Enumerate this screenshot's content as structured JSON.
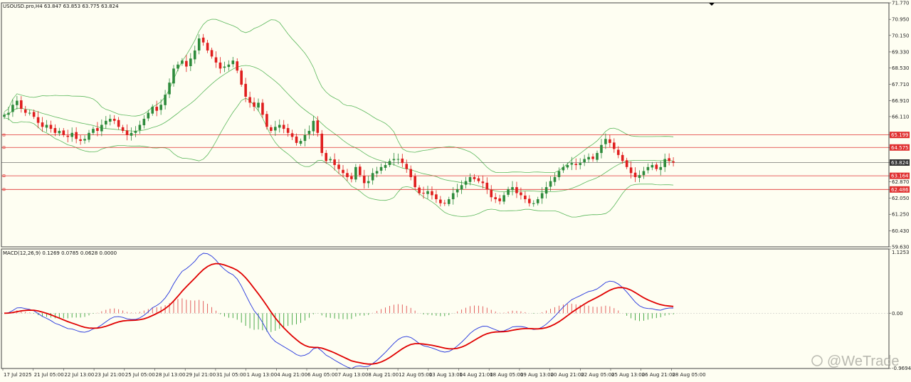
{
  "header": {
    "symbol_info": "USOUSD.pro,H4  63.847 63.853 63.775 63.824",
    "macd_info": "MACD(12,26,9) 0.1269 0.0785 0.0628 0.0000"
  },
  "watermark": "@WeTrade",
  "colors": {
    "background": "#fefef2",
    "bull": "#2e8b3c",
    "bear": "#e01e1e",
    "bands": "#5cb85c",
    "hline": "#e03030",
    "macd_line": "#2233dd",
    "signal_line": "#e00000",
    "hist_pos": "#e05050",
    "hist_neg": "#3aa33a"
  },
  "chart_data": [
    {
      "type": "candlestick",
      "title": "USOUSD.pro,H4",
      "ylim": [
        59.63,
        71.77
      ],
      "y_ticks": [
        "71.770",
        "70.950",
        "70.150",
        "69.330",
        "68.530",
        "67.710",
        "66.910",
        "66.110",
        "65.199",
        "64.575",
        "63.824",
        "63.164",
        "62.870",
        "62.486",
        "62.050",
        "61.250",
        "60.430",
        "59.630"
      ],
      "x_ticks": [
        "17 Jul 2025",
        "21 Jul 05:00",
        "22 Jul 13:00",
        "23 Jul 21:00",
        "25 Jul 05:00",
        "28 Jul 13:00",
        "29 Jul 21:00",
        "31 Jul 05:00",
        "1 Aug 13:00",
        "4 Aug 21:00",
        "6 Aug 05:00",
        "7 Aug 13:00",
        "8 Aug 21:00",
        "12 Aug 05:00",
        "13 Aug 13:00",
        "14 Aug 21:00",
        "18 Aug 05:00",
        "19 Aug 13:00",
        "20 Aug 21:00",
        "22 Aug 05:00",
        "25 Aug 13:00",
        "26 Aug 21:00",
        "28 Aug 05:00"
      ],
      "current_price": 63.824,
      "price_levels": [
        65.199,
        64.575,
        63.164,
        62.486
      ],
      "close": [
        66.2,
        66.3,
        66.7,
        66.9,
        66.5,
        66.3,
        66.3,
        66.1,
        65.8,
        65.6,
        65.7,
        65.5,
        65.3,
        65.4,
        65.2,
        65.1,
        65.3,
        65.0,
        64.9,
        65.0,
        65.3,
        65.5,
        65.4,
        65.7,
        65.9,
        66.0,
        65.9,
        65.6,
        65.4,
        65.2,
        65.3,
        65.4,
        65.7,
        66.0,
        66.3,
        66.6,
        66.4,
        66.7,
        67.2,
        67.8,
        68.5,
        68.7,
        68.9,
        68.6,
        69.0,
        69.4,
        70.0,
        69.8,
        69.4,
        69.1,
        68.8,
        68.5,
        68.6,
        68.7,
        68.9,
        68.4,
        67.7,
        67.1,
        66.8,
        66.6,
        66.8,
        66.2,
        65.6,
        65.4,
        65.6,
        65.7,
        65.5,
        65.3,
        65.1,
        64.8,
        64.9,
        65.2,
        65.4,
        65.9,
        65.3,
        64.3,
        63.9,
        64.0,
        63.7,
        63.5,
        63.3,
        63.1,
        63.0,
        63.6,
        63.2,
        62.8,
        62.9,
        63.3,
        63.4,
        63.6,
        63.7,
        63.9,
        64.0,
        64.0,
        63.8,
        63.5,
        63.1,
        62.6,
        62.3,
        62.3,
        62.4,
        62.2,
        62.0,
        61.8,
        61.8,
        62.0,
        62.3,
        62.5,
        62.7,
        62.9,
        63.1,
        63.0,
        62.9,
        62.8,
        62.5,
        62.1,
        62.0,
        61.9,
        62.2,
        62.5,
        62.6,
        62.3,
        62.2,
        62.0,
        61.8,
        61.8,
        62.0,
        62.3,
        62.6,
        62.9,
        63.1,
        63.4,
        63.6,
        63.7,
        63.8,
        63.7,
        63.8,
        64.0,
        64.1,
        64.0,
        64.3,
        64.7,
        65.0,
        64.8,
        64.5,
        64.2,
        63.9,
        63.6,
        63.3,
        63.1,
        63.2,
        63.4,
        63.6,
        63.7,
        63.5,
        63.6,
        64.0,
        63.9,
        63.82
      ]
    },
    {
      "type": "macd",
      "title": "MACD(12,26,9)",
      "ylim": [
        -0.9694,
        1.1253
      ],
      "y_ticks": [
        "1.1253",
        "0.00",
        "-0.9694"
      ],
      "values": {
        "main": 0.1269,
        "signal": 0.0785,
        "histogram": 0.0628
      }
    }
  ]
}
